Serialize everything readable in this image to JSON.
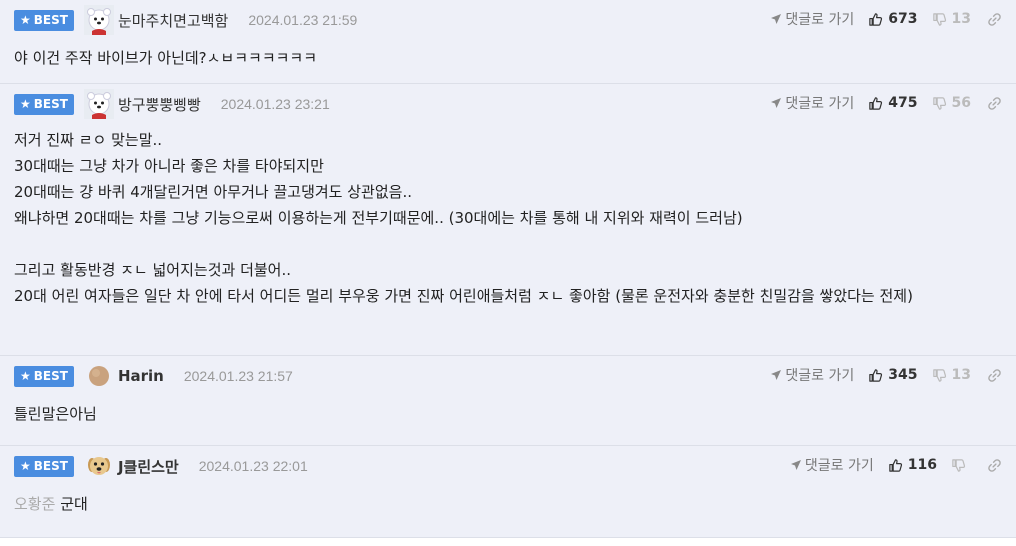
{
  "labels": {
    "best": "BEST",
    "reply": "댓글로 가기"
  },
  "comments": [
    {
      "avatar": "polar-bear",
      "nick": "눈마주치면고백함",
      "date": "2024.01.23 21:59",
      "up": "673",
      "down": "13",
      "text": "야 이건 주작 바이브가 아닌데?ㅅㅂㅋㅋㅋㅋㅋㅋ"
    },
    {
      "avatar": "polar-bear",
      "nick": "방구뿡뿡삥빵",
      "date": "2024.01.23 23:21",
      "up": "475",
      "down": "56",
      "text": "저거 진짜 ㄹㅇ 맞는말..\n30대때는 그냥 차가 아니라 좋은 차를 타야되지만\n20대때는 걍 바퀴 4개달린거면 아무거나 끌고댕겨도 상관없음..\n왜냐하면 20대때는 차를 그냥 기능으로써 이용하는게 전부기때문에.. (30대에는 차를 통해 내 지위와 재력이 드러남)\n\n그리고 활동반경 ㅈㄴ 넓어지는것과 더불어..\n20대 어린 여자들은 일단 차 안에 타서 어디든 멀리 부우웅 가면 진짜 어린애들처럼 ㅈㄴ 좋아함 (물론 운전자와 충분한 친밀감을 쌓았다는 전제)"
    },
    {
      "avatar": "ball",
      "nick": "Harin",
      "date": "2024.01.23 21:57",
      "up": "345",
      "down": "13",
      "text": "틀린말은아님"
    },
    {
      "avatar": "dog",
      "nick": "J클린스만",
      "date": "2024.01.23 22:01",
      "up": "116",
      "down": "",
      "text_muted": "오황준",
      "text": "군대"
    }
  ],
  "icons": {
    "best": "star-icon",
    "reply": "reply-arrow-icon",
    "up": "thumbs-up-icon",
    "down": "thumbs-down-icon",
    "link": "link-icon"
  },
  "colors": {
    "best_badge": "#4a8de0",
    "row_bg": "#eef0f8",
    "date": "#999999"
  }
}
